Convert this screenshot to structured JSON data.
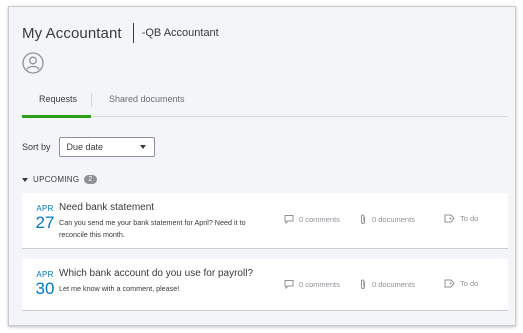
{
  "header": {
    "title": "My Accountant",
    "subtitle": "-QB Accountant"
  },
  "tabs": [
    {
      "label": "Requests",
      "active": true
    },
    {
      "label": "Shared documents",
      "active": false
    }
  ],
  "sort": {
    "label": "Sort by",
    "value": "Due date"
  },
  "section": {
    "label": "UPCOMING",
    "count": "2"
  },
  "requests": [
    {
      "month": "APR",
      "day": "27",
      "title": "Need bank statement",
      "description": "Can you send me your bank statement for April? Need it to reconcile this month.",
      "comments": "0 comments",
      "documents": "0 documents",
      "status": "To do"
    },
    {
      "month": "APR",
      "day": "30",
      "title": "Which bank account do you use for payroll?",
      "description": "Let me know with a comment, please!",
      "comments": "0 comments",
      "documents": "0 documents",
      "status": "To do"
    }
  ],
  "colors": {
    "accent_green": "#2ca01c",
    "date_blue": "#0077c5",
    "background": "#f4f5f8"
  },
  "icons": [
    "avatar-icon",
    "chevron-down-icon",
    "caret-down-icon",
    "comment-icon",
    "paperclip-icon",
    "todo-tag-icon"
  ]
}
